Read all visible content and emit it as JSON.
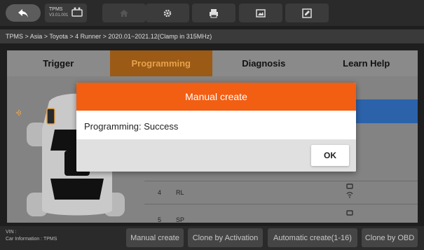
{
  "app": {
    "name": "TPMS",
    "version": "V3.01.001"
  },
  "toolbar": {
    "icons": [
      "back-icon",
      "app-tpms-icon",
      "home-icon",
      "settings-icon",
      "print-icon",
      "screenshot-icon",
      "edit-icon"
    ]
  },
  "breadcrumb": "TPMS > Asia > Toyota > 4 Runner > 2020.01~2021.12(Clamp in 315MHz)",
  "tabs": [
    {
      "label": "Trigger",
      "active": false
    },
    {
      "label": "Programming",
      "active": true
    },
    {
      "label": "Diagnosis",
      "active": false
    },
    {
      "label": "Learn Help",
      "active": false
    }
  ],
  "table": {
    "rows": [
      {
        "num": "4",
        "label": "RL"
      },
      {
        "num": "5",
        "label": "SP"
      }
    ]
  },
  "footer": {
    "vin_label": "VIN :",
    "car_info": "Car Information : TPMS",
    "buttons": [
      "Manual create",
      "Clone by Activation",
      "Automatic create(1-16)",
      "Clone by OBD"
    ]
  },
  "dialog": {
    "title": "Manual create",
    "message": "Programming: Success",
    "ok_label": "OK"
  },
  "colors": {
    "accent": "#f25e12",
    "active_tab": "#9b5a16",
    "selection": "#2b62aa"
  }
}
